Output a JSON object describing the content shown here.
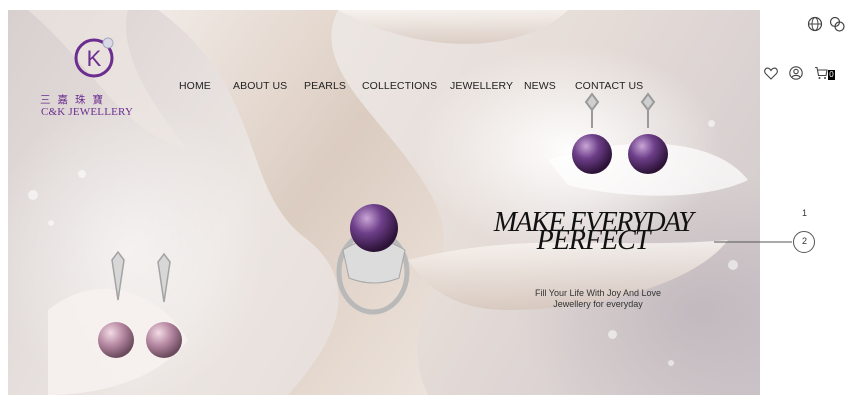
{
  "brand": {
    "name_cn": "三嘉珠寶",
    "name_en": "C&K JEWELLERY",
    "logo_letter": "K",
    "colors": {
      "primary": "#6b2d8f"
    }
  },
  "nav": {
    "items": [
      {
        "label": "HOME"
      },
      {
        "label": "ABOUT US"
      },
      {
        "label": "PEARLS"
      },
      {
        "label": "COLLECTIONS"
      },
      {
        "label": "JEWELLERY"
      },
      {
        "label": "NEWS"
      },
      {
        "label": "CONTACT US"
      }
    ]
  },
  "header_icons": {
    "language_1": "globe-icon",
    "language_2": "translate-icon",
    "wishlist": "heart-icon",
    "account": "user-icon",
    "cart": "cart-icon",
    "cart_count": "0"
  },
  "hero": {
    "headline_line1": "MAKE EVERYDAY",
    "headline_line2": "PERFECT",
    "subtitle_line1": "Fill Your Life With Joy And Love",
    "subtitle_line2": "Jewellery for everyday"
  },
  "slider": {
    "slide_1": "1",
    "slide_2": "2",
    "active": "2"
  }
}
